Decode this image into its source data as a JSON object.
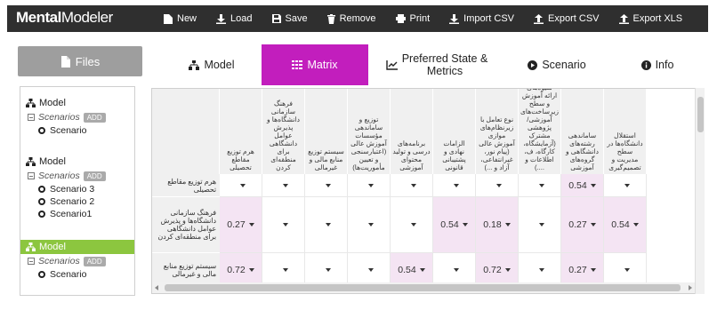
{
  "app": {
    "logo_bold": "Mental",
    "logo_rest": "Modeler"
  },
  "toolbar": [
    {
      "label": "New",
      "icon": "new-icon"
    },
    {
      "label": "Load",
      "icon": "download-icon"
    },
    {
      "label": "Save",
      "icon": "save-icon"
    },
    {
      "label": "Remove",
      "icon": "trash-icon"
    },
    {
      "label": "Print",
      "icon": "print-icon"
    },
    {
      "label": "Import CSV",
      "icon": "download-icon"
    },
    {
      "label": "Export CSV",
      "icon": "upload-icon"
    },
    {
      "label": "Export XLS",
      "icon": "upload-icon"
    }
  ],
  "files_tab": {
    "label": "Files",
    "icon": "file-icon"
  },
  "tabs": [
    {
      "label": "Model",
      "icon": "sitemap-icon",
      "active": false
    },
    {
      "label": "Matrix",
      "icon": "grid-icon",
      "active": true
    },
    {
      "label_line1": "Preferred State &",
      "label_line2": "Metrics",
      "icon": "chart-icon",
      "active": false
    },
    {
      "label": "Scenario",
      "icon": "play-icon",
      "active": false
    },
    {
      "label": "Info",
      "icon": "info-icon",
      "active": false
    }
  ],
  "sidebar": {
    "model_label": "Model",
    "scenarios_label": "Scenarios",
    "add_label": "ADD",
    "groups": [
      {
        "model": "Model",
        "highlighted": false,
        "scenarios": [
          "Scenario"
        ]
      },
      {
        "model": "Model",
        "highlighted": false,
        "scenarios": [
          "Scenario 3",
          "Scenario 2",
          "Scenario1"
        ]
      },
      {
        "model": "Model",
        "highlighted": true,
        "scenarios": [
          "Scenario"
        ]
      }
    ]
  },
  "matrix": {
    "columns": [
      "استقلال دانشگاه‌ها در سطح مدیریت و تصمیم‌گیری",
      "ساماندهی رشته‌های دانشگاهی و گروه‌های آموزشی",
      "شیوه‌های ارائه آموزش و سطح زیرساخت‌های آموزشی/پژوهشی مشترک (آزمایشگاه، کارگاه، ف، اطلاعات و ....)",
      "نوع تعامل با زیرنظام‌های موازی آموزش عالی (پیام نور، غیرانتفاعی، آزاد و ...)",
      "الزامات نهادی و پشتیبانی قانونی",
      "برنامه‌های درسی و تولید محتوای آموزشی",
      "توزیع و ساماندهی مؤسسات آموزش عالی (اعتبارسنجی و تعیین مأموریت‌ها)",
      "سیستم توزیع منابع مالی و غیرمالی",
      "فرهنگ سازمانی دانشگاه‌ها و پذیرش عوامل دانشگاهی برای منطقه‌ای کردن",
      "هرم توزیع مقاطع تحصیلی"
    ],
    "rows": [
      {
        "label": "هرم توزیع مقاطع تحصیلی",
        "cells": [
          "",
          "0.54",
          "",
          "",
          "",
          "",
          "",
          "",
          "",
          ""
        ]
      },
      {
        "label": "فرهنگ سازمانی دانشگاه‌ها و پذیرش عوامل دانشگاهی برای منطقه‌ای کردن",
        "cells": [
          "0.54",
          "0.27",
          "",
          "0.18",
          "0.54",
          "",
          "",
          "",
          "",
          "0.27"
        ]
      },
      {
        "label": "سیستم توزیع منابع مالی و غیرمالی",
        "cells": [
          "",
          "0.27",
          "",
          "0.72",
          "",
          "0.54",
          "",
          "",
          "",
          "0.72"
        ]
      }
    ]
  }
}
